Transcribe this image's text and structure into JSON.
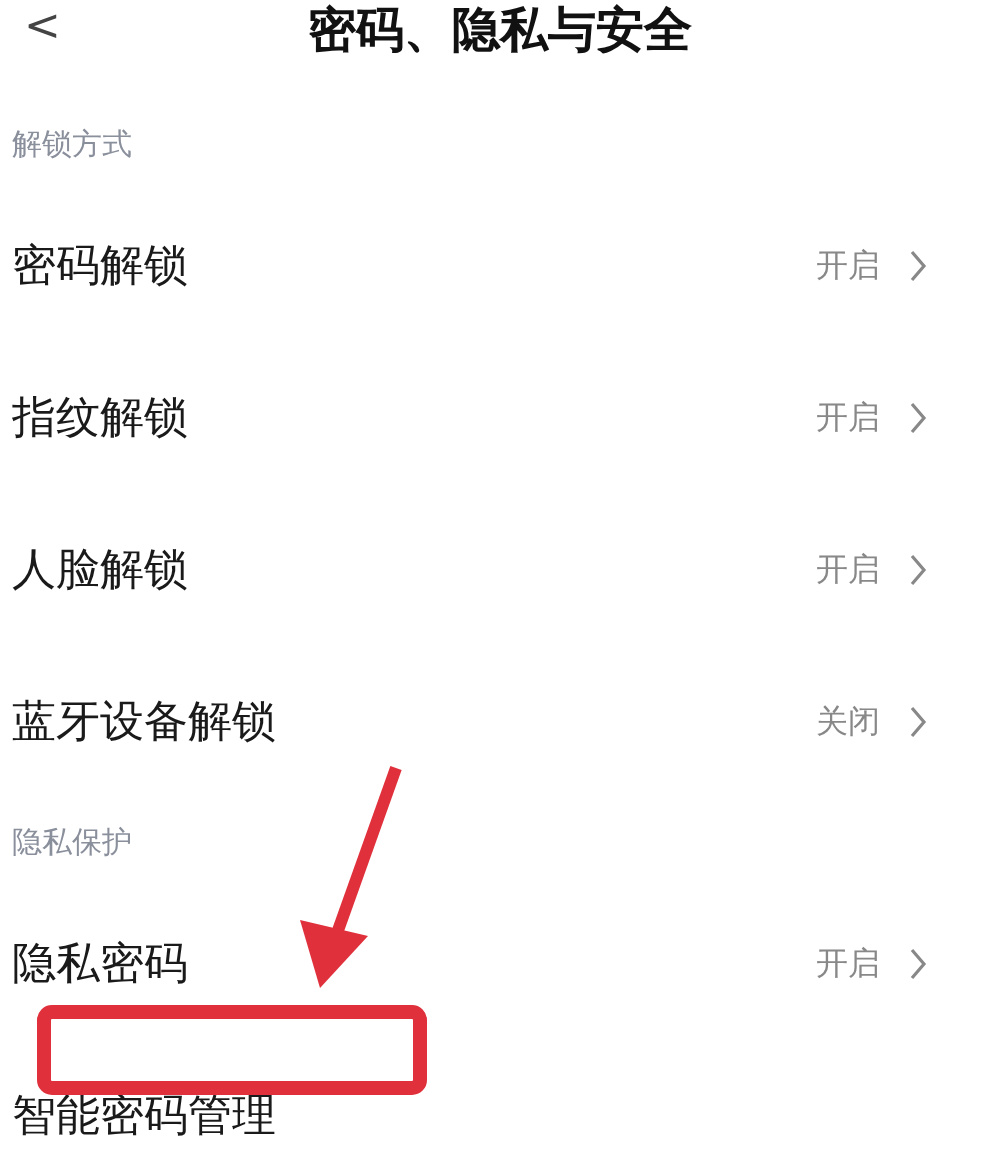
{
  "header": {
    "back": "<",
    "title": "密码、隐私与安全"
  },
  "sections": [
    {
      "header": "解锁方式",
      "items": [
        {
          "label": "密码解锁",
          "value": "开启"
        },
        {
          "label": "指纹解锁",
          "value": "开启"
        },
        {
          "label": "人脸解锁",
          "value": "开启"
        },
        {
          "label": "蓝牙设备解锁",
          "value": "关闭"
        }
      ]
    },
    {
      "header": "隐私保护",
      "items": [
        {
          "label": "隐私密码",
          "value": "开启"
        },
        {
          "label": "智能密码管理"
        }
      ]
    }
  ],
  "annotations": [
    {
      "kind": "arrow"
    },
    {
      "kind": "highlight-box"
    }
  ]
}
